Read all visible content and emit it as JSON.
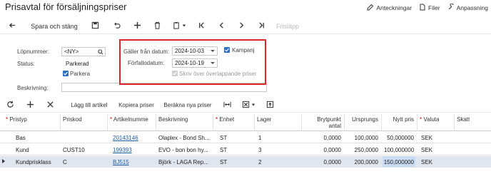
{
  "header": {
    "title": "Prisavtal för försäljningspriser",
    "links": [
      "Anteckningar",
      "Filer",
      "Anpassning"
    ]
  },
  "toolbar": {
    "save_close_label": "Spara och stäng",
    "release_label": "Frisläpp"
  },
  "form": {
    "lopnummer_label": "Löpnummer:",
    "lopnummer_value": "<NY>",
    "status_label": "Status:",
    "status_value": "Parkerad",
    "parkera_label": "Parkera",
    "galler_label": "Gäller från datum:",
    "galler_value": "2024-10-03",
    "forfallo_label": "Förfallodatum:",
    "forfallo_value": "2024-10-19",
    "kampanj_label": "Kampanj",
    "skriv_over_label": "Skriv över överlappande priser",
    "beskrivning_label": "Beskrivning:",
    "beskrivning_value": ""
  },
  "grid_toolbar": {
    "add_article": "Lägg till artikel",
    "copy_prices": "Kopiera priser",
    "calc_prices": "Beräkna nya priser"
  },
  "grid": {
    "headers": {
      "pristyp": "Pristyp",
      "priskod": "Priskod",
      "artikelnummer": "Artikelnumme",
      "beskrivning": "Beskrivning",
      "enhet": "Enhet",
      "lager": "Lager",
      "brytpunkt1": "Brytpunkt",
      "brytpunkt2": "antal",
      "ursprungs": "Ursprungs",
      "nytt_pris": "Nytt pris",
      "valuta": "Valuta",
      "skatt": "Skatt"
    },
    "rows": [
      {
        "pristyp": "Bas",
        "priskod": "",
        "artikel": "20143146",
        "beskrivning": "Olaplex - Bond Sh...",
        "enhet": "ST",
        "lager": "1",
        "brytpunkt": "0,0000",
        "ursprungs": "100,0000",
        "nytt_pris": "50,000000",
        "valuta": "SEK",
        "skatt": ""
      },
      {
        "pristyp": "Kund",
        "priskod": "CUST10",
        "artikel": "199393",
        "beskrivning": "EVO - bon bon hy...",
        "enhet": "ST",
        "lager": "3",
        "brytpunkt": "0,0000",
        "ursprungs": "250,0000",
        "nytt_pris": "100,000000",
        "valuta": "SEK",
        "skatt": ""
      },
      {
        "pristyp": "Kundprisklass",
        "priskod": "C",
        "artikel": "BJ515",
        "beskrivning": "Björk - LAGA Rep...",
        "enhet": "ST",
        "lager": "2",
        "brytpunkt": "0,0000",
        "ursprungs": "200,0000",
        "nytt_pris": "150,000000",
        "valuta": "SEK",
        "skatt": ""
      }
    ]
  },
  "colors": {
    "accent": "#2f6fbf",
    "highlight_box": "#e0262d",
    "link": "#1f5fa8",
    "selected_row": "#dfe6ef"
  }
}
